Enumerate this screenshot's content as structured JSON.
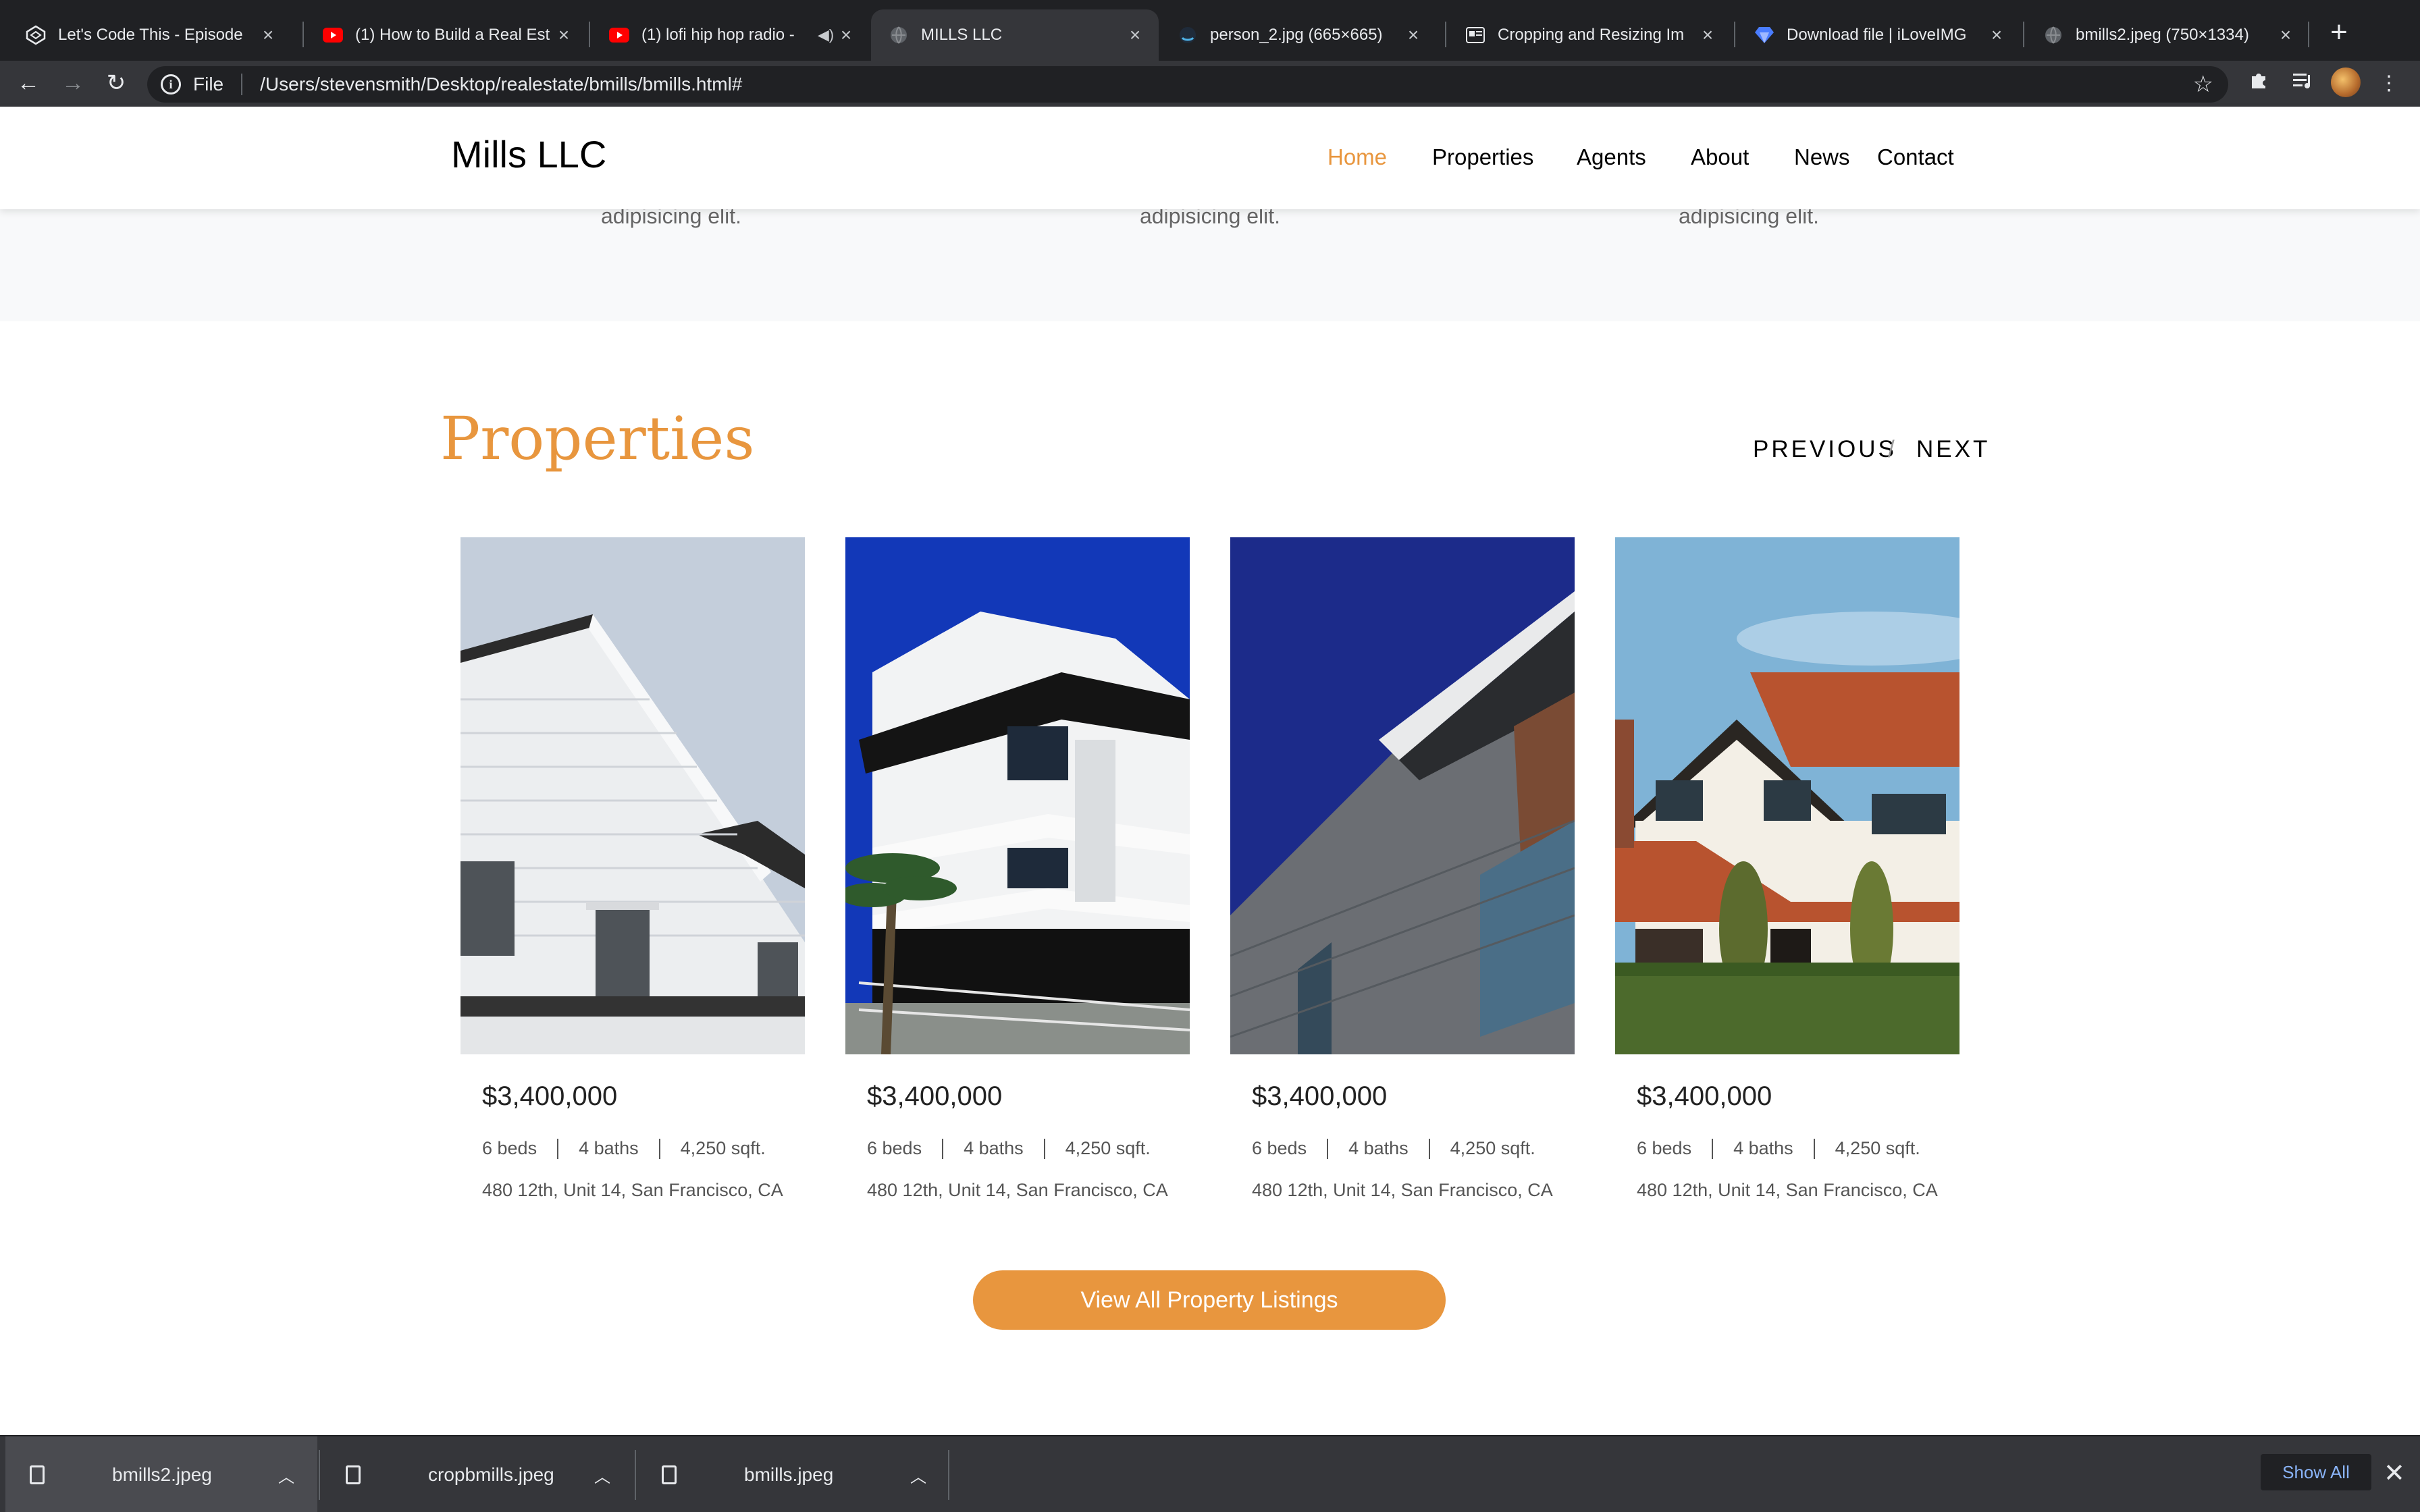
{
  "browser": {
    "tabs": [
      {
        "title": "Let's Code This - Episode",
        "icon": "codepen-icon"
      },
      {
        "title": "(1) How to Build a Real Est",
        "icon": "youtube-icon"
      },
      {
        "title": "(1) lofi hip hop radio -",
        "icon": "youtube-icon"
      },
      {
        "title": "MILLS LLC",
        "icon": "globe-icon",
        "active": true
      },
      {
        "title": "person_2.jpg (665×665)",
        "icon": "image-icon"
      },
      {
        "title": "Cropping and Resizing Im",
        "icon": "article-icon"
      },
      {
        "title": "Download file | iLoveIMG",
        "icon": "iloveimg-icon"
      },
      {
        "title": "bmills2.jpeg (750×1334)",
        "icon": "globe-icon"
      }
    ],
    "address": {
      "scheme": "File",
      "url": "/Users/stevensmith/Desktop/realestate/bmills/bmills.html#"
    }
  },
  "site": {
    "logo": "Mills LLC",
    "nav": [
      "Home",
      "Properties",
      "Agents",
      "About",
      "News",
      "Contact"
    ],
    "active_nav": "Home",
    "accent_color": "#e8963e"
  },
  "features_tail": [
    "adipisicing elit.",
    "adipisicing elit.",
    "adipisicing elit."
  ],
  "properties": {
    "title": "Properties",
    "previous": "PREVIOUS",
    "separator": "/",
    "next": "NEXT",
    "cards": [
      {
        "price": "$3,400,000",
        "beds": "6 beds",
        "baths": "4 baths",
        "area": "4,250 sqft.",
        "address": "480 12th, Unit 14, San Francisco, CA",
        "image": "white-gabled-house"
      },
      {
        "price": "$3,400,000",
        "beds": "6 beds",
        "baths": "4 baths",
        "area": "4,250 sqft.",
        "address": "480 12th, Unit 14, San Francisco, CA",
        "image": "white-modern-apartment"
      },
      {
        "price": "$3,400,000",
        "beds": "6 beds",
        "baths": "4 baths",
        "area": "4,250 sqft.",
        "address": "480 12th, Unit 14, San Francisco, CA",
        "image": "dark-brick-building"
      },
      {
        "price": "$3,400,000",
        "beds": "6 beds",
        "baths": "4 baths",
        "area": "4,250 sqft.",
        "address": "480 12th, Unit 14, San Francisco, CA",
        "image": "tudor-house"
      }
    ],
    "view_all": "View All Property Listings"
  },
  "downloads": {
    "items": [
      "bmills2.jpeg",
      "cropbmills.jpeg",
      "bmills.jpeg"
    ],
    "show_all": "Show All"
  }
}
